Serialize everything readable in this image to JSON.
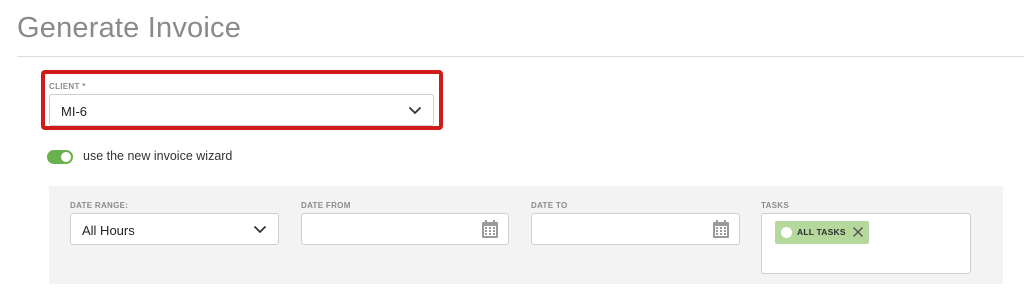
{
  "page": {
    "title": "Generate Invoice"
  },
  "client": {
    "label": "CLIENT *",
    "value": "MI-6"
  },
  "wizard_toggle": {
    "label": "use the new invoice wizard",
    "on": true
  },
  "filters": {
    "date_range": {
      "label": "DATE RANGE:",
      "value": "All Hours"
    },
    "date_from": {
      "label": "DATE FROM",
      "value": ""
    },
    "date_to": {
      "label": "DATE TO",
      "value": ""
    },
    "tasks": {
      "label": "TASKS",
      "chips": [
        "ALL TASKS"
      ]
    }
  },
  "colors": {
    "highlight": "#d11a1a",
    "toggle_on": "#6ab04c",
    "chip_bg": "#b5d99c",
    "panel_bg": "#f3f3f3"
  },
  "icons": [
    "chevron-down-icon",
    "calendar-icon",
    "close-icon"
  ]
}
